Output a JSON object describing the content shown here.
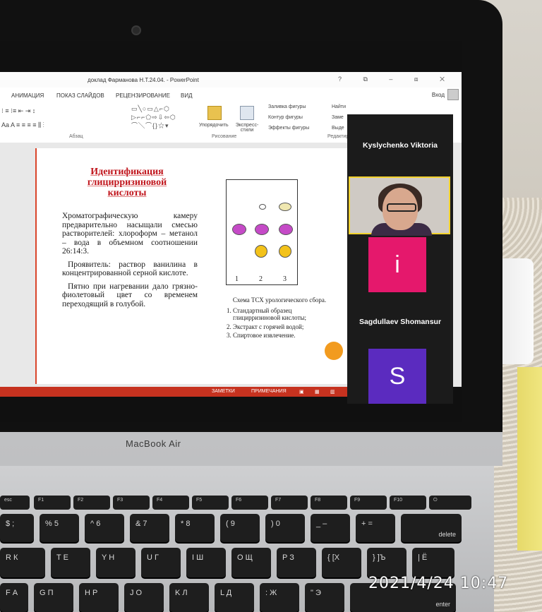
{
  "powerpoint": {
    "window_title": "доклад Фарманова Н.Т.24.04. - PowerPoint",
    "window_controls": [
      "?",
      "□",
      "–",
      "⧉",
      "✕"
    ],
    "tabs": [
      "АНИМАЦИЯ",
      "ПОКАЗ СЛАЙДОВ",
      "РЕЦЕНЗИРОВАНИЕ",
      "ВИД"
    ],
    "sign_in": "Вход",
    "ribbon": {
      "group_paragraph": "Абзац",
      "group_drawing": "Рисование",
      "group_editing": "Редактир",
      "arrange": "Упорядочить",
      "quick_styles": "Экспресс-стили",
      "shape_fill": "Заливка фигуры",
      "shape_outline": "Контур фигуры",
      "shape_effects": "Эффекты фигуры",
      "find": "Найти",
      "replace": "Заме",
      "select": "Выде"
    },
    "status_bar": {
      "notes": "ЗАМЕТКИ",
      "comments": "ПРИМЕЧАНИЯ"
    }
  },
  "slide": {
    "title_line1": "Идентификация",
    "title_line2": "глицирризиновой",
    "title_line3": "кислоты",
    "para1": "Хроматографическую камеру предварительно насыщали смесью растворителей: хлороформ – метанол – вода в объемном соотношении 26:14:3.",
    "para2": "Проявитель: раствор ванилина в концентрированной серной кислоте.",
    "para3": "Пятно при нагревании дало грязно-фиолетовый цвет со временем переходящий в голубой.",
    "tlc_lanes": [
      "1",
      "2",
      "3"
    ],
    "scheme_caption": "Схема ТСХ урологического сбора.",
    "scheme_items": [
      "Стандартный образец глицирризиновой кислоты;",
      "Экстракт с горячей водой;",
      "Спиртовое извлечение."
    ]
  },
  "zoom": {
    "participant_1": "Kyslychenko Viktoria",
    "participant_2_initial": "i",
    "participant_3": "Sagdullaev Shomansur",
    "participant_3_initial": "S",
    "colors": {
      "speaker_border": "#f2d22e",
      "avatar_i": "#e5186c",
      "avatar_s": "#5b2bbf"
    }
  },
  "laptop": {
    "brand": "MacBook Air"
  },
  "keyboard": {
    "fn_row": [
      "esc",
      "F1",
      "F2",
      "F3",
      "F4",
      "F5",
      "F6",
      "F7",
      "F8",
      "F9",
      "F10",
      "F11",
      "F12",
      "⏻"
    ],
    "row1": [
      "$\n;",
      "%\n5",
      "^\n6",
      "&\n7",
      "*\n8",
      "(\n9",
      ")\n0",
      "_\n–",
      "+\n=",
      "delete"
    ],
    "row2": [
      "R\nК",
      "T\nЕ",
      "Y\nН",
      "U\nГ",
      "I\nШ",
      "O\nЩ",
      "P\nЗ",
      "{\n[Х",
      "}\n]Ъ",
      "|\nЁ"
    ],
    "row3": [
      "F\nА",
      "G\nП",
      "H\nР",
      "J\nО",
      "K\nЛ",
      "L\nД",
      ":\nЖ",
      "\"\nЭ",
      "enter"
    ]
  },
  "photo_timestamp": "2021/4/24  10:47"
}
